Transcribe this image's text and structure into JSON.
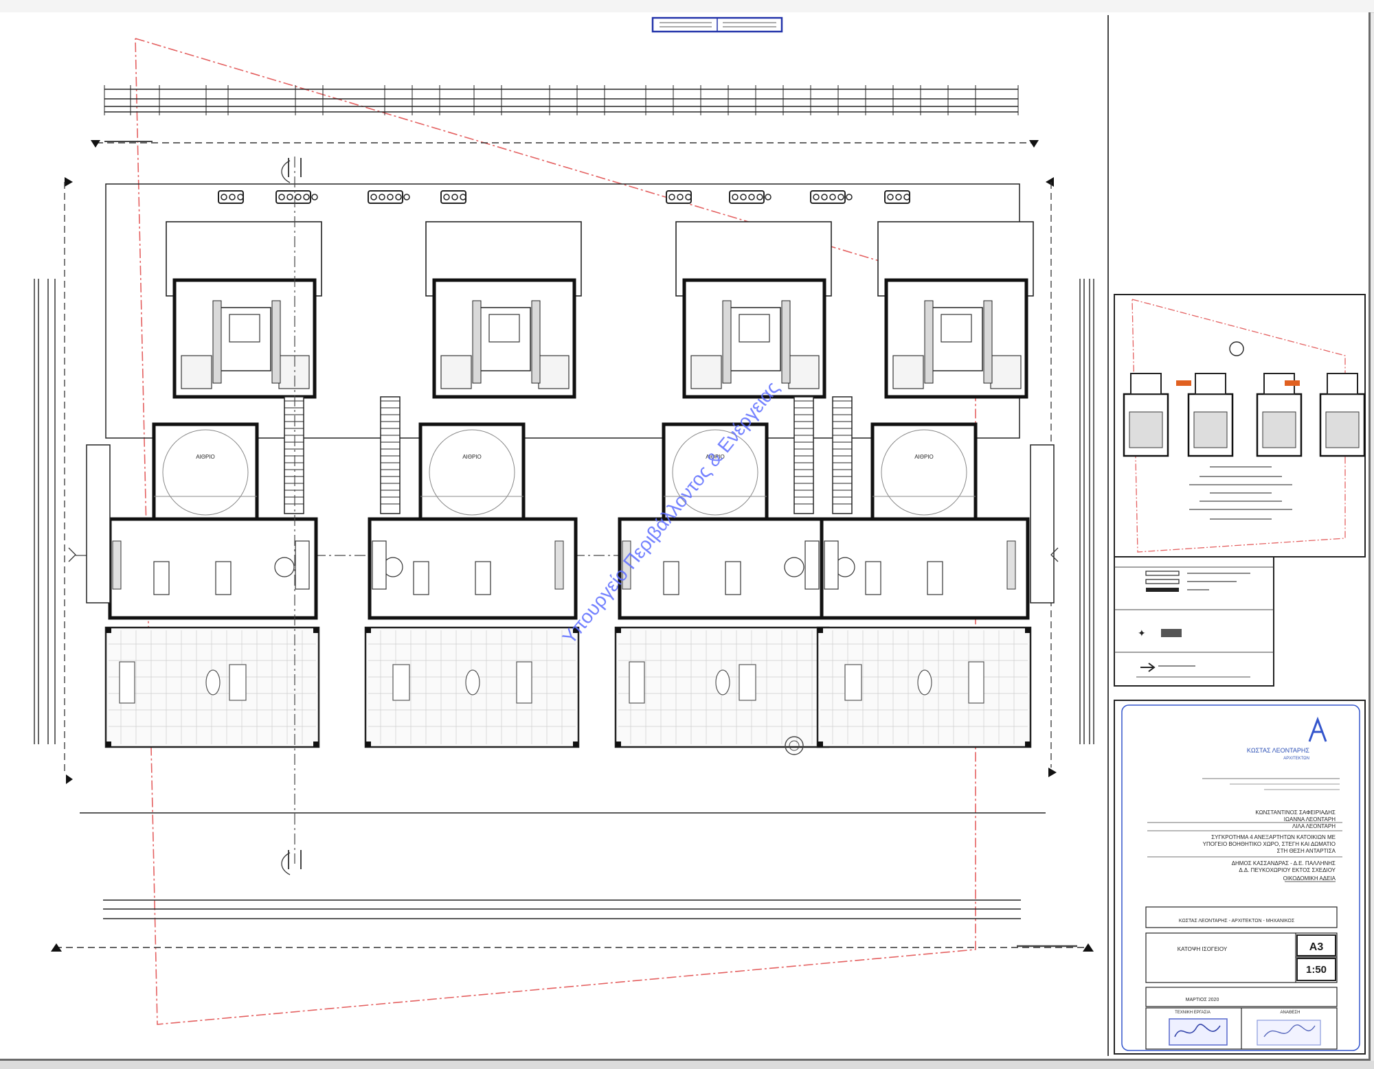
{
  "sheet": {
    "room_label_line1": "ΑΙΘΡΙΟ",
    "room_label_line2": "ΑΙΘΡΙΟ",
    "watermark": "Υπουργείο Περιβάλλοντος & Ενέργειας"
  },
  "title_block": {
    "firm_name": "ΚΩΣΤΑΣ ΛΕΟΝΤΑΡΗΣ",
    "firm_subtitle": "ΑΡΧΙΤΕΚΤΩΝ",
    "owners": [
      "ΚΩΝΣΤΑΝΤΙΝΟΣ ΣΑΦΕΙΡΙΑΔΗΣ",
      "ΙΩΑΝΝΑ ΛΕΟΝΤΑΡΗ",
      "ΛΙΛΑ ΛΕΟΝΤΑΡΗ"
    ],
    "project": [
      "ΣΥΓΚΡΟΤΗΜΑ 4 ΑΝΕΞΑΡΤΗΤΩΝ ΚΑΤΟΙΚΙΩΝ ΜΕ",
      "ΥΠΟΓΕΙΟ ΒΟΗΘΗΤΙΚΟ ΧΩΡΟ, ΣΤΕΓΗ ΚΑΙ ΔΩΜΑΤΙΟ",
      "ΣΤΗ ΘΕΣΗ ΑΝΤΑΡΤΙΣΑ"
    ],
    "location": [
      "ΔΗΜΟΣ ΚΑΣΣΑΝΔΡΑΣ - Δ.Ε. ΠΑΛΛΗΝΗΣ",
      "Δ.Δ. ΠΕΥΚΟΧΩΡΙΟΥ ΕΚΤΟΣ ΣΧΕΔΙΟΥ"
    ],
    "permit": "ΟΙΚΟΔΟΜΙΚΗ ΑΔΕΙΑ",
    "designer": "ΚΩΣΤΑΣ ΛΕΟΝΤΑΡΗΣ - ΑΡΧΙΤΕΚΤΩΝ - ΜΗΧΑΝΙΚΟΣ",
    "drawing_title": "ΚΑΤΟΨΗ ΙΣΟΓΕΙΟΥ",
    "paper": "A3",
    "scale": "1:50",
    "date": "ΜΑΡΤΙΟΣ 2020",
    "seal_left_caption": "ΤΕΧΝΙΚΗ ΕΡΓΑΣΙΑ",
    "seal_right_caption": "ΑΝΑΘΕΣΗ"
  }
}
